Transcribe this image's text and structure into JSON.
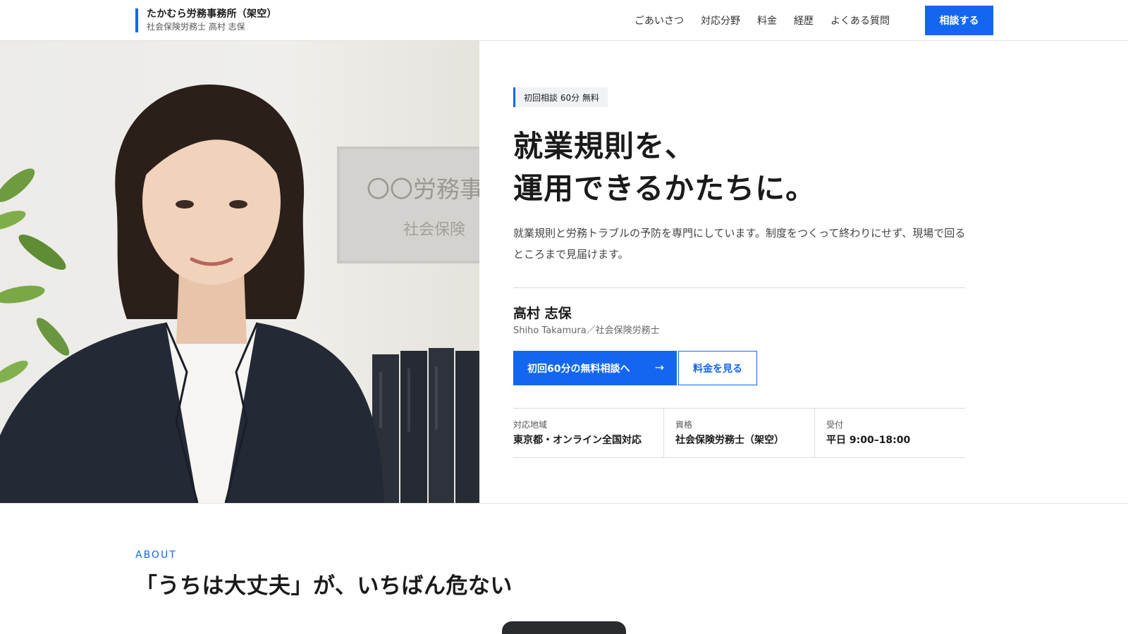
{
  "header": {
    "brand_name": "たかむら労務事務所（架空）",
    "brand_sub": "社会保険労務士 高村 志保",
    "nav": [
      "ごあいさつ",
      "対応分野",
      "料金",
      "経歴",
      "よくある質問"
    ],
    "cta_label": "相談する"
  },
  "hero": {
    "photo_sign_line1": "〇〇労務事",
    "photo_sign_line2": "社会保険",
    "badge": "初回相談 60分 無料",
    "headline_line1": "就業規則を、",
    "headline_line2": "運用できるかたちに。",
    "lead": "就業規則と労務トラブルの予防を専門にしています。制度をつくって終わりにせず、現場で回るところまで見届けます。",
    "person_name": "高村 志保",
    "person_sub": "Shiho Takamura／社会保険労務士",
    "primary_button": "初回60分の無料相談へ",
    "primary_arrow": "→",
    "secondary_button": "料金を見る",
    "info": [
      {
        "label": "対応地域",
        "value": "東京都・オンライン全国対応"
      },
      {
        "label": "資格",
        "value": "社会保険労務士（架空）"
      },
      {
        "label": "受付",
        "value": "平日 9:00–18:00"
      }
    ]
  },
  "about": {
    "label": "ABOUT",
    "title": "「うちは大丈夫」が、いちばん危ない"
  },
  "colors": {
    "accent": "#1466f0",
    "text": "#1a1a1a",
    "divider": "#dcdcdc"
  }
}
